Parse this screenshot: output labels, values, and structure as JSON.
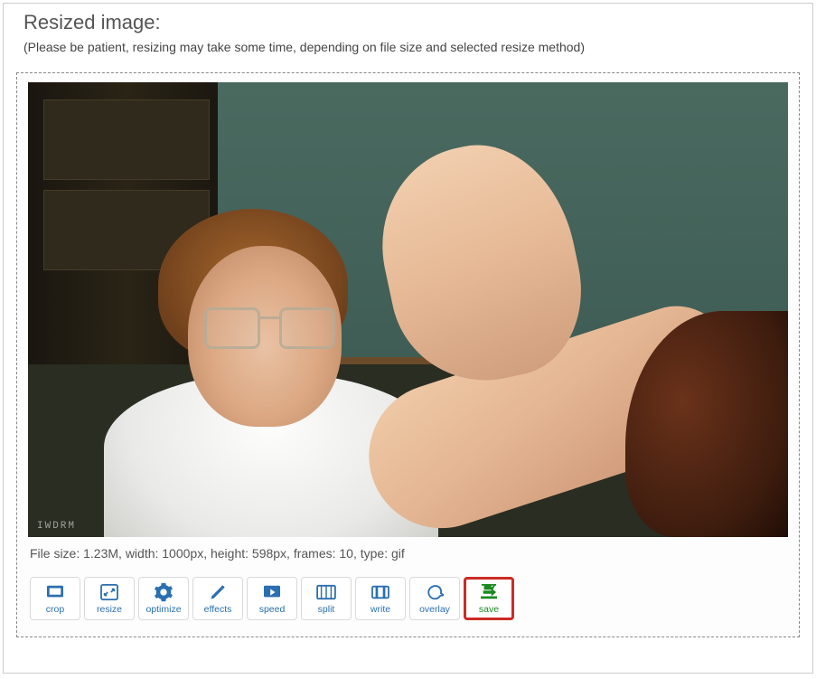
{
  "heading": "Resized image:",
  "note": "(Please be patient, resizing may take some time, depending on file size and selected resize method)",
  "watermark": "IWDRM",
  "fileinfo": "File size: 1.23M, width: 1000px, height: 598px, frames: 10, type: gif",
  "toolbar": {
    "crop": "crop",
    "resize": "resize",
    "optimize": "optimize",
    "effects": "effects",
    "speed": "speed",
    "split": "split",
    "write": "write",
    "overlay": "overlay",
    "save": "save"
  }
}
